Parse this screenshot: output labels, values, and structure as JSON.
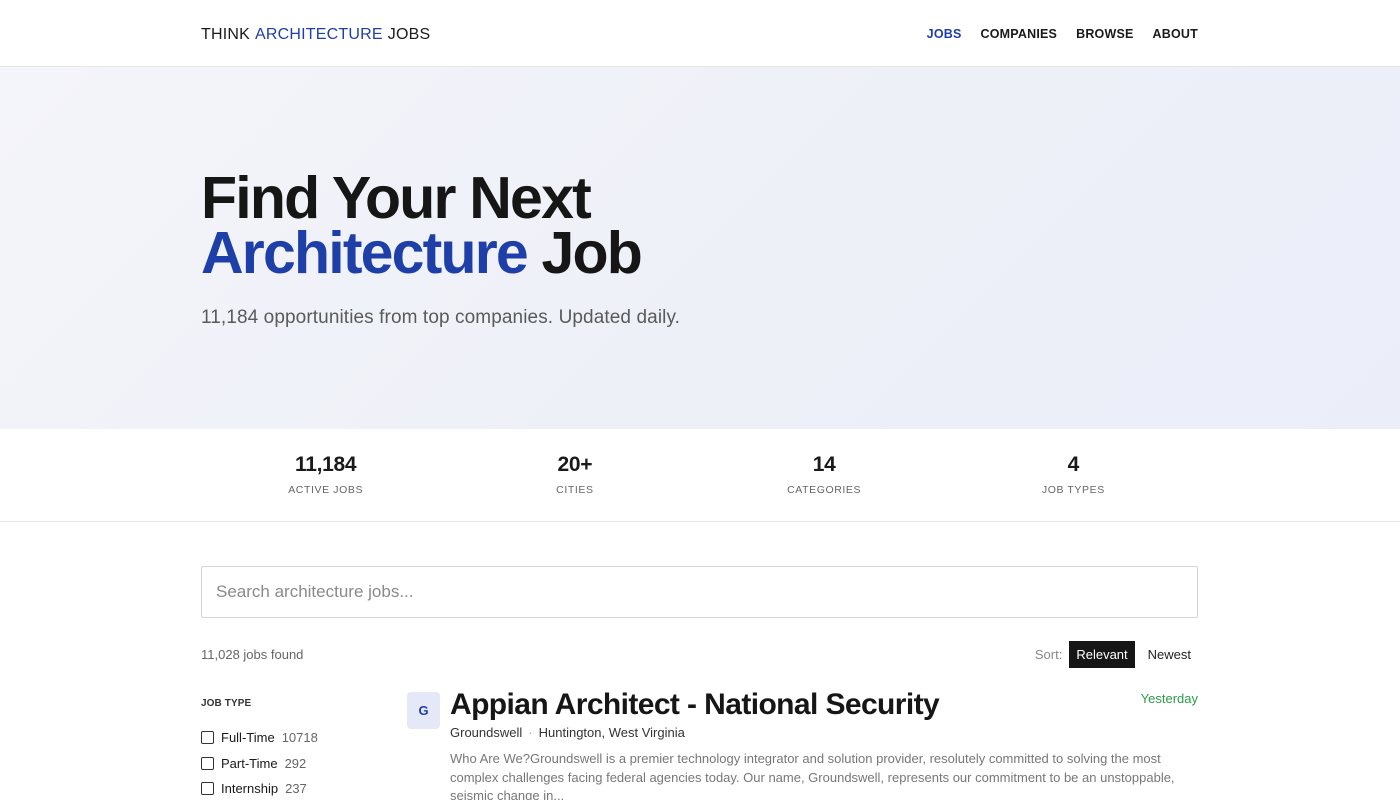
{
  "header": {
    "logo": {
      "part1": "THINK",
      "part2": "ARCHITECTURE",
      "part3": "JOBS"
    },
    "nav": [
      "JOBS",
      "COMPANIES",
      "BROWSE",
      "ABOUT"
    ]
  },
  "hero": {
    "line1": "Find Your Next",
    "line2_accent": "Architecture",
    "line2_rest": "Job",
    "subtitle": "11,184 opportunities from top companies. Updated daily."
  },
  "stats": [
    {
      "value": "11,184",
      "label": "ACTIVE JOBS"
    },
    {
      "value": "20+",
      "label": "CITIES"
    },
    {
      "value": "14",
      "label": "CATEGORIES"
    },
    {
      "value": "4",
      "label": "JOB TYPES"
    }
  ],
  "search": {
    "placeholder": "Search architecture jobs..."
  },
  "results": {
    "count_text": "11,028 jobs found",
    "sort_label": "Sort:",
    "sort_options": [
      "Relevant",
      "Newest"
    ],
    "sort_selected": "Relevant"
  },
  "filters": {
    "heading": "JOB TYPE",
    "items": [
      {
        "label": "Full-Time",
        "count": "10718"
      },
      {
        "label": "Part-Time",
        "count": "292"
      },
      {
        "label": "Internship",
        "count": "237"
      }
    ]
  },
  "job": {
    "avatar": "G",
    "title": "Appian Architect - National Security",
    "company": "Groundswell",
    "location": "Huntington, West Virginia",
    "description": "Who Are We?Groundswell is a premier technology integrator and solution provider, resolutely committed to solving the most complex challenges facing federal agencies today. Our name, Groundswell, represents our commitment to be an unstoppable, seismic change in...",
    "posted": "Yesterday"
  },
  "colors": {
    "accent": "#1e3fa8",
    "posted": "#2a9d4a"
  }
}
